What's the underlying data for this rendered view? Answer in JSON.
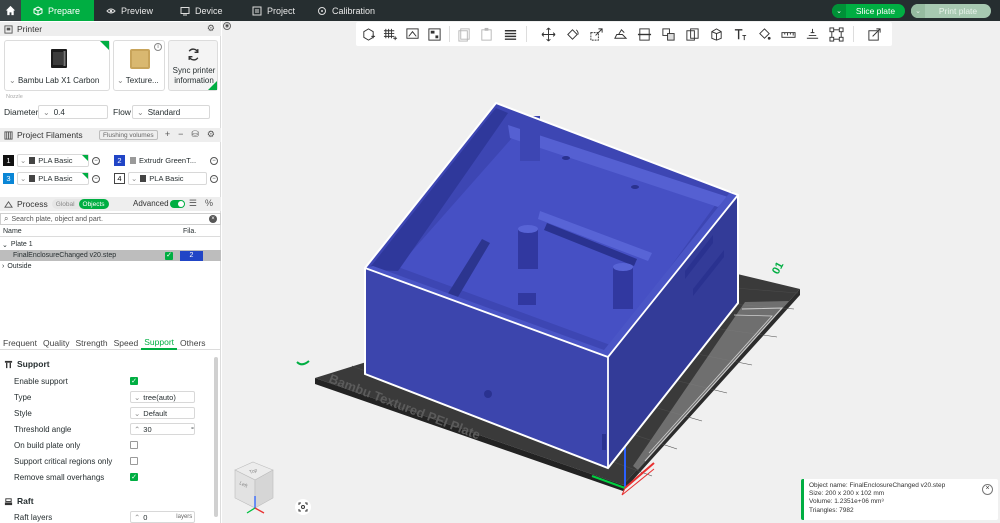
{
  "topbar": {
    "tabs": [
      {
        "label": "Prepare",
        "icon": "cube-icon"
      },
      {
        "label": "Preview",
        "icon": "eye-icon"
      },
      {
        "label": "Device",
        "icon": "device-icon"
      },
      {
        "label": "Project",
        "icon": "project-icon"
      },
      {
        "label": "Calibration",
        "icon": "calibration-icon"
      }
    ],
    "slice_label": "Slice plate",
    "print_label": "Print plate"
  },
  "printer": {
    "section_title": "Printer",
    "printer_name": "Bambu Lab X1 Carbon",
    "plate_name": "Texture...",
    "sync_label_1": "Sync printer",
    "sync_label_2": "information",
    "nozzle_label": "Nozzle",
    "diameter_label": "Diameter",
    "diameter_value": "0.4",
    "flow_label": "Flow",
    "flow_value": "Standard"
  },
  "filaments": {
    "section_title": "Project Filaments",
    "flushing_label": "Flushing volumes",
    "items": [
      {
        "num": "1",
        "color": "#111111",
        "num_color": "#ffffff",
        "name": "PLA Basic"
      },
      {
        "num": "2",
        "color": "#2145c6",
        "num_color": "#ffffff",
        "name": "Extrudr GreenT..."
      },
      {
        "num": "3",
        "color": "#0a86d6",
        "num_color": "#ffffff",
        "name": "PLA Basic"
      },
      {
        "num": "4",
        "color": "#ffffff",
        "num_color": "#111111",
        "name": "PLA Basic"
      }
    ]
  },
  "process": {
    "section_title": "Process",
    "global_label": "Global",
    "objects_label": "Objects",
    "advanced_label": "Advanced",
    "search_placeholder": "Search plate, object and part.",
    "col_name": "Name",
    "col_fila": "Fila.",
    "plate_label": "Plate 1",
    "object_name": "FinalEnclosureChanged v20.step",
    "object_filament": "2",
    "outside_label": "Outside"
  },
  "param_tabs": [
    "Frequent",
    "Quality",
    "Strength",
    "Speed",
    "Support",
    "Others"
  ],
  "support": {
    "group_title": "Support",
    "enable_label": "Enable support",
    "type_label": "Type",
    "type_value": "tree(auto)",
    "style_label": "Style",
    "style_value": "Default",
    "threshold_label": "Threshold angle",
    "threshold_value": "30",
    "threshold_unit": "°",
    "on_build_plate_label": "On build plate only",
    "critical_label": "Support critical regions only",
    "remove_overhangs_label": "Remove small overhangs"
  },
  "raft": {
    "group_title": "Raft",
    "layers_label": "Raft layers",
    "layers_value": "0",
    "layers_unit": "layers"
  },
  "viewport": {
    "plate_text": "Bambu Textured PEI Plate",
    "plate_number": "01",
    "cube_top": "Top",
    "cube_left": "Left",
    "info_lines": [
      "Object name: FinalEnclosureChanged v20.step",
      "Size: 200 x 200 x 102 mm",
      "Volume: 1.2351e+06 mm³",
      "Triangles: 7982"
    ]
  },
  "colors": {
    "accent": "#00ae42",
    "model_blue": "#3d46b3",
    "topbar": "#262e30"
  }
}
